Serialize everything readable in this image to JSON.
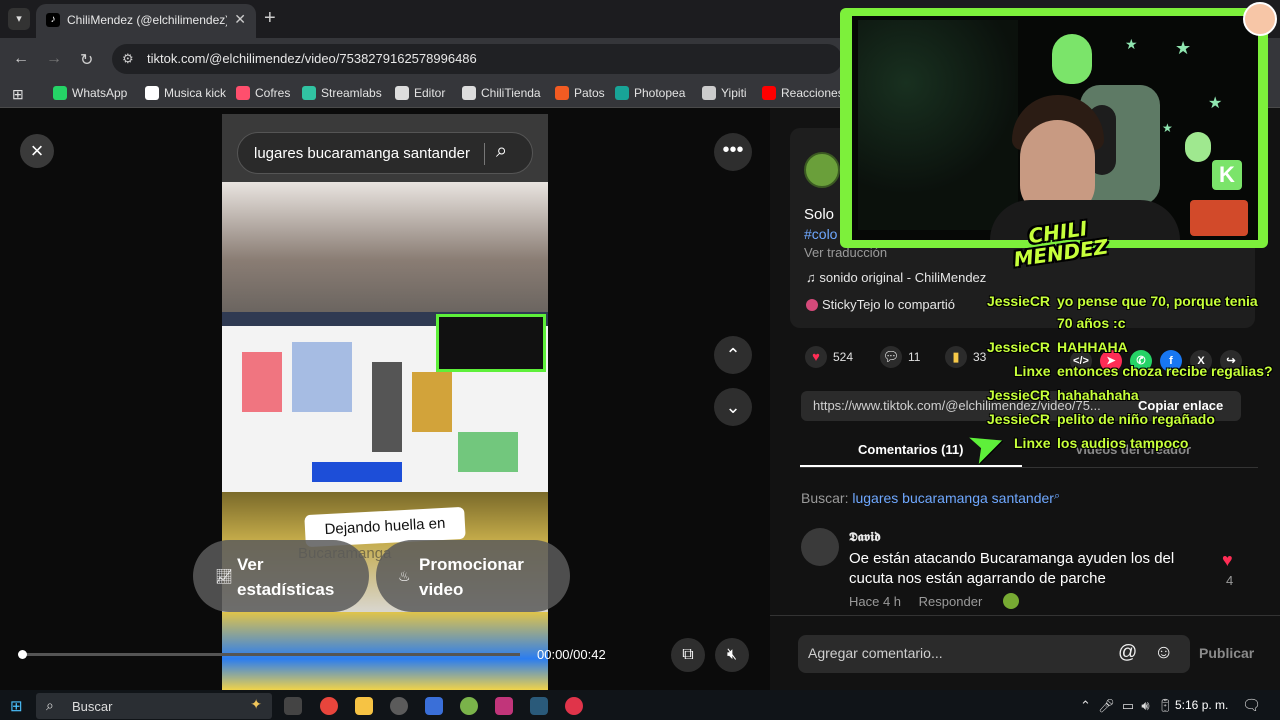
{
  "browser": {
    "tab_title": "ChiliMendez (@elchilimendez) |",
    "url": "tiktok.com/@elchilimendez/video/7538279162578996486"
  },
  "bookmarks": [
    {
      "label": "WhatsApp",
      "color": "#25d366"
    },
    {
      "label": "Musica kick",
      "color": "#ffffff"
    },
    {
      "label": "Cofres",
      "color": "#ff4f6d"
    },
    {
      "label": "Streamlabs",
      "color": "#31c3a2"
    },
    {
      "label": "Editor",
      "color": "#dddddd"
    },
    {
      "label": "ChiliTienda",
      "color": "#dddddd"
    },
    {
      "label": "Patos",
      "color": "#f25b22"
    },
    {
      "label": "Photopea",
      "color": "#18a497"
    },
    {
      "label": "Yipiti",
      "color": "#cccccc"
    },
    {
      "label": "Reacciones",
      "color": "#ff0000"
    }
  ],
  "video": {
    "search_query": "lugares bucaramanga santander",
    "caption": "Dejando huella en",
    "caption2": "Bucaramanga",
    "actions": [
      {
        "label": "Ver estadísticas"
      },
      {
        "label": "Promocionar video"
      }
    ],
    "time": "00:00/00:42",
    "progress_fraction": 0.0
  },
  "panel": {
    "desc_line1": "Solo",
    "desc_line2": "#colo",
    "translate": "Ver traducción",
    "sound": "♫  sonido original - ChiliMendez",
    "shared": "StickyTejo lo compartió",
    "stats": {
      "likes": "524",
      "comments": "11",
      "saves": "33"
    },
    "link": "https://www.tiktok.com/@elchilimendez/video/75...",
    "copy_label": "Copiar enlace",
    "tabs": {
      "comments": "Comentarios (11)",
      "creator": "Videos del creador"
    },
    "search_label": "Buscar:",
    "search_term": "lugares bucaramanga santander",
    "comment": {
      "user": "𝕯𝖆𝖛𝖎𝖉",
      "text": "Oe están atacando Bucaramanga ayuden los del cucuta nos están agarrando de parche",
      "time": "Hace 4 h",
      "reply": "Responder",
      "likes": "4"
    },
    "add_comment_placeholder": "Agregar comentario...",
    "publish": "Publicar"
  },
  "stream": {
    "logo_line1": "CHILI",
    "logo_line2": "MENDEZ",
    "chat": [
      {
        "user": "JessieCR",
        "msg": "yo pense que 70, porque tenia"
      },
      {
        "user": "",
        "msg": "70 años :c"
      },
      {
        "user": "JessieCR",
        "msg": "HAHHAHA"
      },
      {
        "user": "Linxe",
        "msg": "entonces choza recibe regalias?"
      },
      {
        "user": "JessieCR",
        "msg": "hahahahaha"
      },
      {
        "user": "JessieCR",
        "msg": "pelito de niño regañado"
      },
      {
        "user": "Linxe",
        "msg": "los audios tampoco"
      }
    ]
  },
  "taskbar": {
    "search": "Buscar",
    "clock": "5:16 p. m."
  }
}
